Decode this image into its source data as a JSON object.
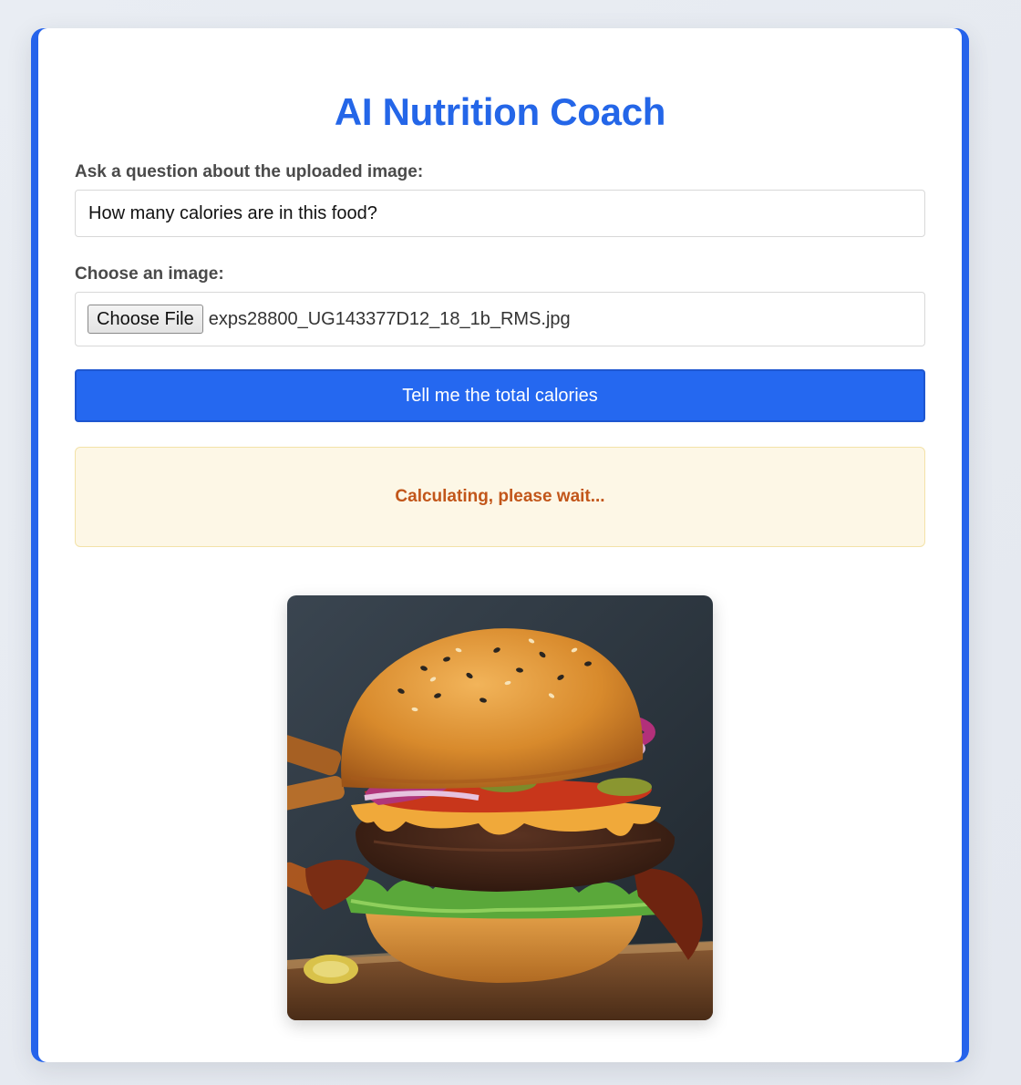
{
  "app": {
    "title": "AI Nutrition Coach"
  },
  "form": {
    "question_label": "Ask a question about the uploaded image:",
    "question_value": "How many calories are in this food?",
    "image_label": "Choose an image:",
    "file_button_label": "Choose File",
    "file_name": "exps28800_UG143377D12_18_1b_RMS.jpg",
    "submit_label": "Tell me the total calories"
  },
  "status": {
    "message": "Calculating, please wait..."
  },
  "preview": {
    "subject": "burger-image"
  },
  "colors": {
    "accent": "#2563eb",
    "status_text": "#c2561a",
    "status_background": "#fdf7e6"
  }
}
